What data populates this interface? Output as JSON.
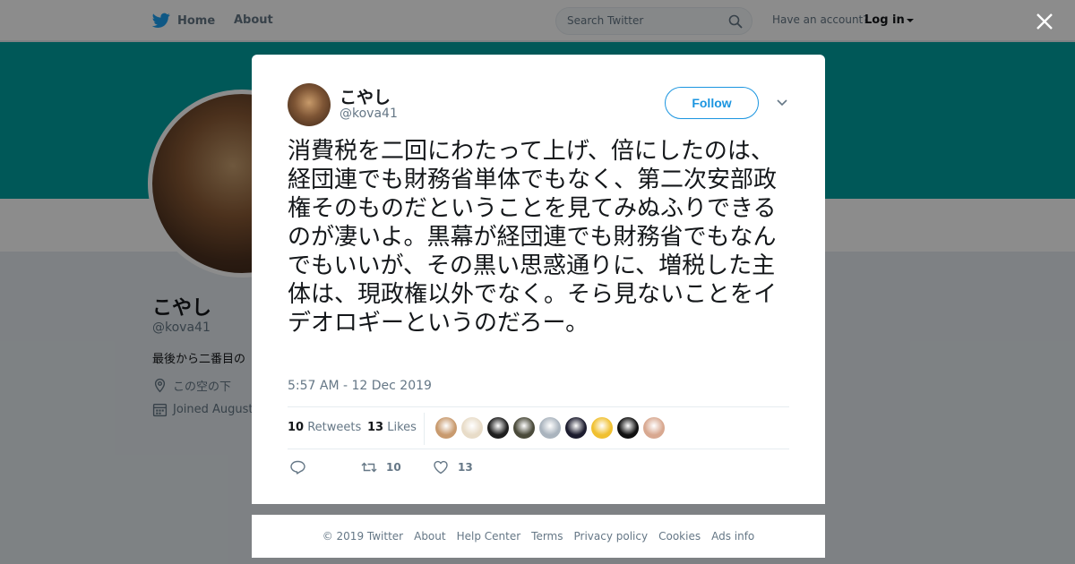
{
  "topbar": {
    "home_label": "Home",
    "about_label": "About",
    "search_placeholder": "Search Twitter",
    "account_prompt": "Have an account?",
    "login_label": "Log in"
  },
  "profile": {
    "name": "こやし",
    "handle": "@kova41",
    "bio": "最後から二番目の",
    "location": "この空の下",
    "joined": "Joined August"
  },
  "tweet": {
    "author_name": "こやし",
    "author_handle": "@kova41",
    "follow_label": "Follow",
    "text": "消費税を二回にわたって上げ、倍にしたのは、経団連でも財務省単体でもなく、第二次安部政権そのものだということを見てみぬふりできるのが凄いよ。黒幕が経団連でも財務省でもなんでもいいが、その黒い思惑通りに、増税した主体は、現政権以外でなく。そら見ないことをイデオロギーというのだろー。",
    "timestamp": "5:57 AM - 12 Dec 2019",
    "retweets_count": "10",
    "retweets_label": "Retweets",
    "likes_count": "13",
    "likes_label": "Likes",
    "action_retweet_count": "10",
    "action_like_count": "13",
    "liker_avatar_colors": [
      "#c89a6e",
      "#e8dcc8",
      "#1e1e1e",
      "#4a4a3a",
      "#aab4be",
      "#1c1c2e",
      "#f0c030",
      "#101010",
      "#d8a890"
    ]
  },
  "footer": {
    "links": [
      "© 2019 Twitter",
      "About",
      "Help Center",
      "Terms",
      "Privacy policy",
      "Cookies",
      "Ads info"
    ]
  },
  "colors": {
    "accent": "#1b95e0",
    "banner": "#00a0a0",
    "muted": "#657786"
  }
}
